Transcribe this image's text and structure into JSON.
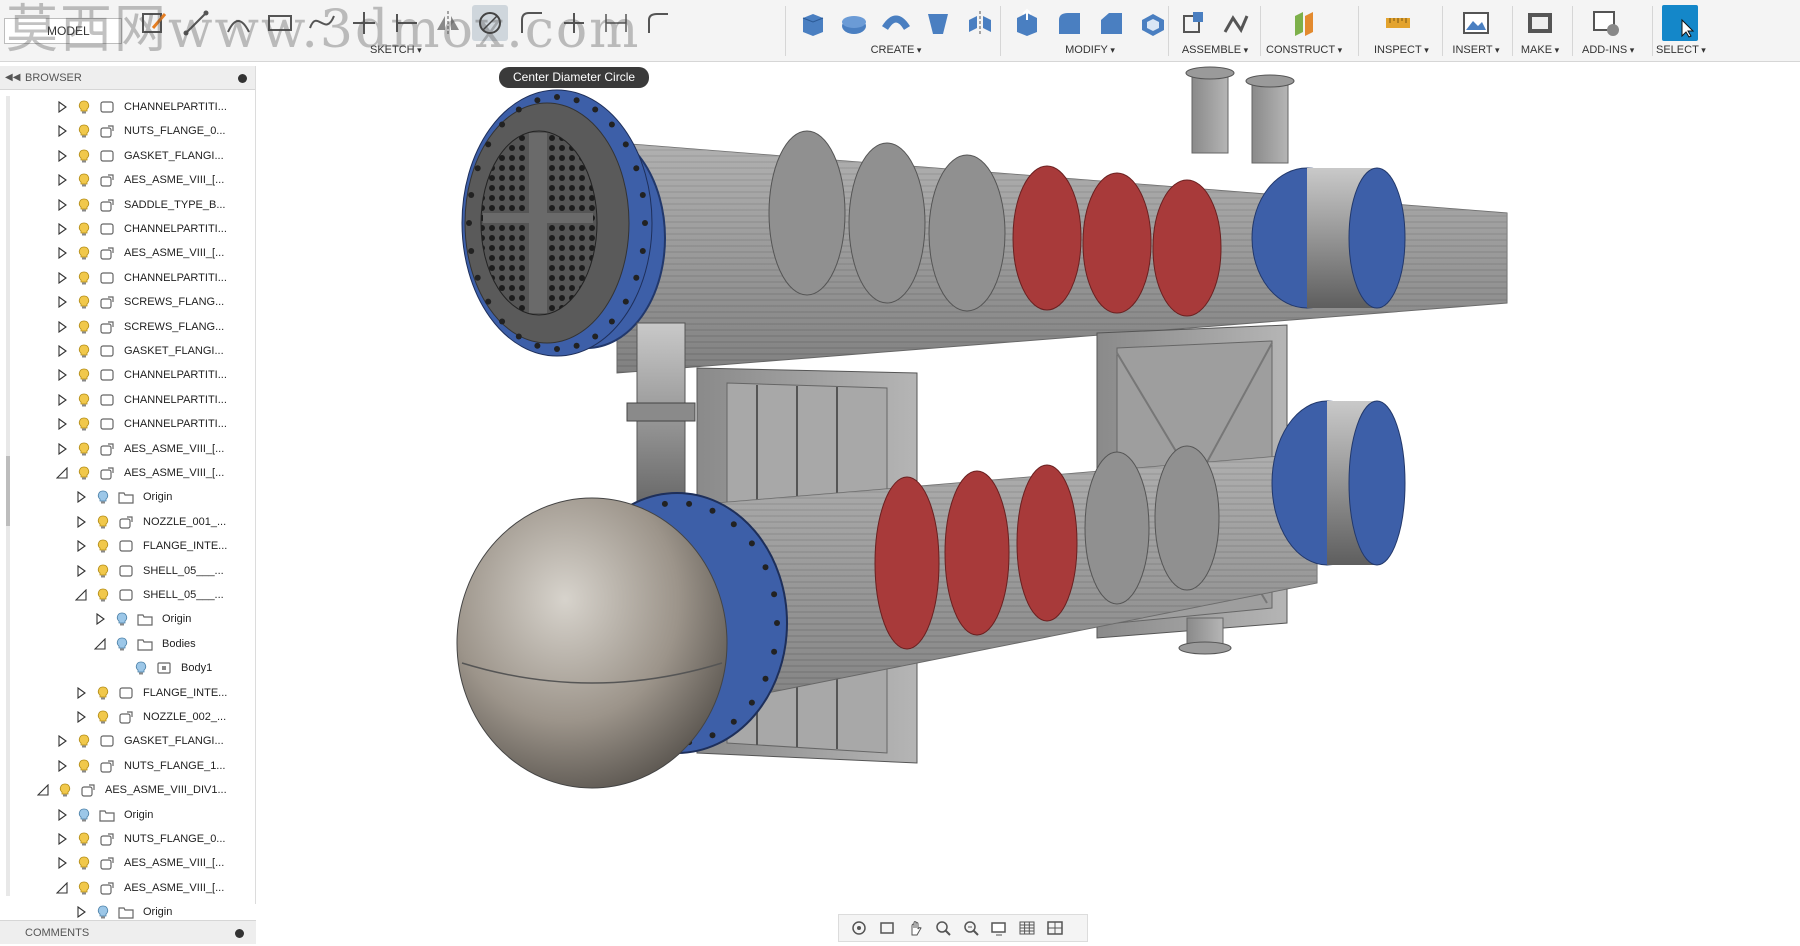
{
  "toolbar": {
    "workspace": "MODEL",
    "groups": [
      {
        "label": "SKETCH"
      },
      {
        "label": "CREATE"
      },
      {
        "label": "MODIFY"
      },
      {
        "label": "ASSEMBLE"
      },
      {
        "label": "CONSTRUCT"
      },
      {
        "label": "INSPECT"
      },
      {
        "label": "INSERT"
      },
      {
        "label": "MAKE"
      },
      {
        "label": "ADD-INS"
      },
      {
        "label": "SELECT"
      }
    ]
  },
  "watermark": "莫西网www.3dmox.com",
  "tooltip": "Center Diameter Circle",
  "browser": {
    "title": "BROWSER",
    "items": [
      {
        "label": "CHANNELPARTITI...",
        "icon": "component-icon",
        "state": "collapsed"
      },
      {
        "label": "NUTS_FLANGE_0...",
        "icon": "component-link-icon",
        "state": "collapsed"
      },
      {
        "label": "GASKET_FLANGI...",
        "icon": "component-icon",
        "state": "collapsed"
      },
      {
        "label": "AES_ASME_VIII_[...",
        "icon": "component-link-icon",
        "state": "collapsed"
      },
      {
        "label": "SADDLE_TYPE_B...",
        "icon": "component-link-icon",
        "state": "collapsed"
      },
      {
        "label": "CHANNELPARTITI...",
        "icon": "component-icon",
        "state": "collapsed"
      },
      {
        "label": "AES_ASME_VIII_[...",
        "icon": "component-link-icon",
        "state": "collapsed"
      },
      {
        "label": "CHANNELPARTITI...",
        "icon": "component-icon",
        "state": "collapsed"
      },
      {
        "label": "SCREWS_FLANG...",
        "icon": "component-link-icon",
        "state": "collapsed"
      },
      {
        "label": "SCREWS_FLANG...",
        "icon": "component-link-icon",
        "state": "collapsed"
      },
      {
        "label": "GASKET_FLANGI...",
        "icon": "component-icon",
        "state": "collapsed"
      },
      {
        "label": "CHANNELPARTITI...",
        "icon": "component-icon",
        "state": "collapsed"
      },
      {
        "label": "CHANNELPARTITI...",
        "icon": "component-icon",
        "state": "collapsed"
      },
      {
        "label": "CHANNELPARTITI...",
        "icon": "component-icon",
        "state": "collapsed"
      },
      {
        "label": "AES_ASME_VIII_[...",
        "icon": "component-link-icon",
        "state": "collapsed"
      },
      {
        "label": "AES_ASME_VIII_[...",
        "icon": "component-link-icon",
        "state": "expanded"
      },
      {
        "label": "Origin",
        "icon": "folder-icon",
        "state": "collapsed"
      },
      {
        "label": "NOZZLE_001_...",
        "icon": "component-link-icon",
        "state": "collapsed"
      },
      {
        "label": "FLANGE_INTE...",
        "icon": "component-icon",
        "state": "collapsed"
      },
      {
        "label": "SHELL_05___...",
        "icon": "component-icon",
        "state": "collapsed"
      },
      {
        "label": "SHELL_05___...",
        "icon": "component-icon",
        "state": "expanded"
      },
      {
        "label": "Origin",
        "icon": "folder-icon",
        "state": "collapsed"
      },
      {
        "label": "Bodies",
        "icon": "folder-icon",
        "state": "expanded"
      },
      {
        "label": "Body1",
        "icon": "body-icon",
        "state": "none"
      },
      {
        "label": "FLANGE_INTE...",
        "icon": "component-icon",
        "state": "collapsed"
      },
      {
        "label": "NOZZLE_002_...",
        "icon": "component-link-icon",
        "state": "collapsed"
      },
      {
        "label": "GASKET_FLANGI...",
        "icon": "component-icon",
        "state": "collapsed"
      },
      {
        "label": "NUTS_FLANGE_1...",
        "icon": "component-link-icon",
        "state": "collapsed"
      },
      {
        "label": "AES_ASME_VIII_DIV1...",
        "icon": "component-link-icon",
        "state": "expanded"
      },
      {
        "label": "Origin",
        "icon": "folder-icon",
        "state": "collapsed"
      },
      {
        "label": "NUTS_FLANGE_0...",
        "icon": "component-link-icon",
        "state": "collapsed"
      },
      {
        "label": "AES_ASME_VIII_[...",
        "icon": "component-link-icon",
        "state": "collapsed"
      },
      {
        "label": "AES_ASME_VIII_[...",
        "icon": "component-link-icon",
        "state": "expanded"
      },
      {
        "label": "Origin",
        "icon": "folder-icon",
        "state": "collapsed"
      }
    ]
  },
  "comments": {
    "title": "COMMENTS"
  },
  "colors": {
    "flange_blue": "#3d5fa8",
    "baffle_red": "#a83a3a",
    "steel": "#8e8e8e",
    "select_accent": "#1487c9"
  }
}
